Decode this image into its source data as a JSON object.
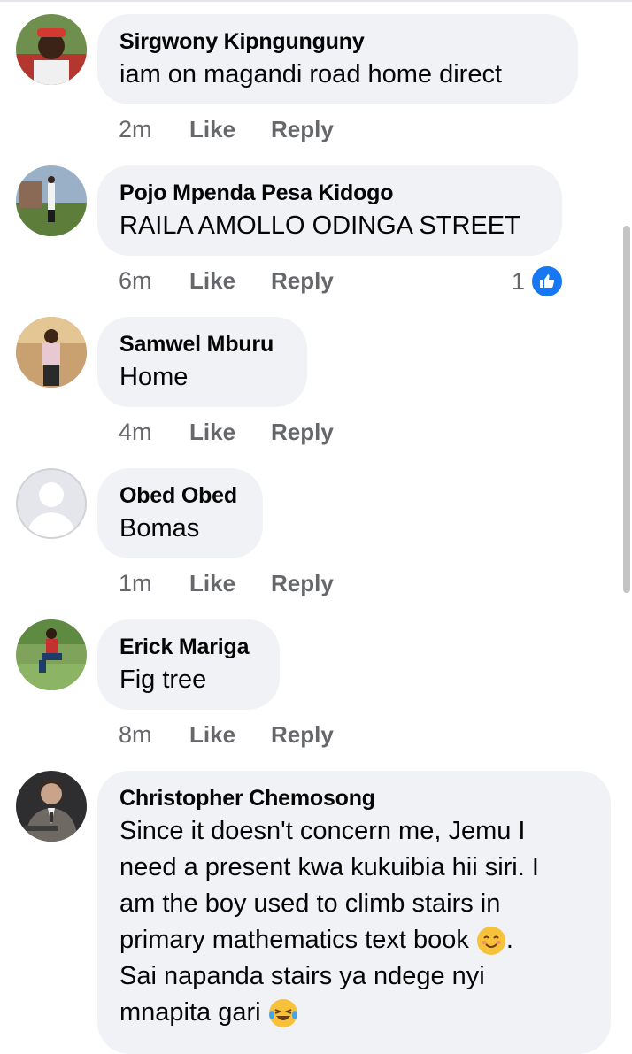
{
  "colors": {
    "bubble": "#f0f2f5",
    "meta_text": "#65676b",
    "like_blue": "#1877f2"
  },
  "comments": [
    {
      "author": "Sirgwony Kipngunguny",
      "text": "iam on magandi road home direct",
      "time": "2m",
      "like": "Like",
      "reply": "Reply"
    },
    {
      "author": "Pojo Mpenda Pesa Kidogo",
      "text": "RAILA AMOLLO ODINGA STREET",
      "time": "6m",
      "like": "Like",
      "reply": "Reply",
      "reactions": {
        "count": "1",
        "icon": "thumbs-up-icon"
      }
    },
    {
      "author": "Samwel Mburu",
      "text": "Home",
      "time": "4m",
      "like": "Like",
      "reply": "Reply"
    },
    {
      "author": "Obed Obed",
      "text": "Bomas",
      "time": "1m",
      "like": "Like",
      "reply": "Reply"
    },
    {
      "author": "Erick Mariga",
      "text": "Fig tree",
      "time": "8m",
      "like": "Like",
      "reply": "Reply"
    },
    {
      "author": "Christopher Chemosong",
      "text_lines": [
        "Since it doesn't concern me, Jemu I",
        "need a present kwa kukuibia hii siri. I",
        "am the boy used to climb stairs in",
        "primary mathematics text book",
        ".",
        "Sai napanda stairs ya ndege nyi",
        "mnapita gari"
      ],
      "emojis": [
        "smiling-face-emoji",
        "tears-of-joy-emoji"
      ]
    }
  ]
}
